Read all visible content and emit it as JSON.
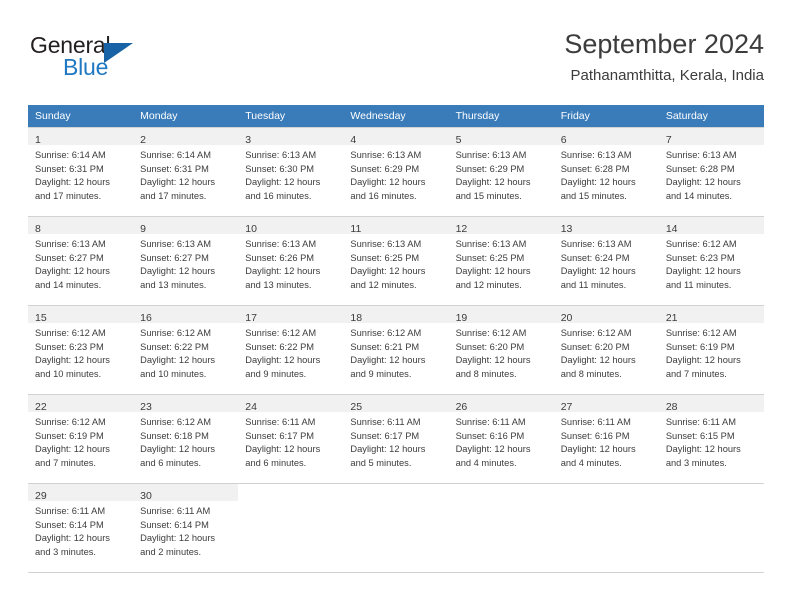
{
  "brand": {
    "name_top": "General",
    "name_bottom": "Blue",
    "triangle_color": "#1763a6",
    "blue_color": "#1f78c1"
  },
  "header": {
    "title": "September 2024",
    "subtitle": "Pathanamthitta, Kerala, India"
  },
  "theme": {
    "header_row_bg": "#3a7cba",
    "daynum_bg": "#f1f1f1",
    "text_color": "#3c3c3c",
    "grid_line": "#d2d2d2"
  },
  "weekdays": [
    "Sunday",
    "Monday",
    "Tuesday",
    "Wednesday",
    "Thursday",
    "Friday",
    "Saturday"
  ],
  "weeks": [
    [
      {
        "day": "1",
        "sunrise": "Sunrise: 6:14 AM",
        "sunset": "Sunset: 6:31 PM",
        "daylight1": "Daylight: 12 hours",
        "daylight2": "and 17 minutes."
      },
      {
        "day": "2",
        "sunrise": "Sunrise: 6:14 AM",
        "sunset": "Sunset: 6:31 PM",
        "daylight1": "Daylight: 12 hours",
        "daylight2": "and 17 minutes."
      },
      {
        "day": "3",
        "sunrise": "Sunrise: 6:13 AM",
        "sunset": "Sunset: 6:30 PM",
        "daylight1": "Daylight: 12 hours",
        "daylight2": "and 16 minutes."
      },
      {
        "day": "4",
        "sunrise": "Sunrise: 6:13 AM",
        "sunset": "Sunset: 6:29 PM",
        "daylight1": "Daylight: 12 hours",
        "daylight2": "and 16 minutes."
      },
      {
        "day": "5",
        "sunrise": "Sunrise: 6:13 AM",
        "sunset": "Sunset: 6:29 PM",
        "daylight1": "Daylight: 12 hours",
        "daylight2": "and 15 minutes."
      },
      {
        "day": "6",
        "sunrise": "Sunrise: 6:13 AM",
        "sunset": "Sunset: 6:28 PM",
        "daylight1": "Daylight: 12 hours",
        "daylight2": "and 15 minutes."
      },
      {
        "day": "7",
        "sunrise": "Sunrise: 6:13 AM",
        "sunset": "Sunset: 6:28 PM",
        "daylight1": "Daylight: 12 hours",
        "daylight2": "and 14 minutes."
      }
    ],
    [
      {
        "day": "8",
        "sunrise": "Sunrise: 6:13 AM",
        "sunset": "Sunset: 6:27 PM",
        "daylight1": "Daylight: 12 hours",
        "daylight2": "and 14 minutes."
      },
      {
        "day": "9",
        "sunrise": "Sunrise: 6:13 AM",
        "sunset": "Sunset: 6:27 PM",
        "daylight1": "Daylight: 12 hours",
        "daylight2": "and 13 minutes."
      },
      {
        "day": "10",
        "sunrise": "Sunrise: 6:13 AM",
        "sunset": "Sunset: 6:26 PM",
        "daylight1": "Daylight: 12 hours",
        "daylight2": "and 13 minutes."
      },
      {
        "day": "11",
        "sunrise": "Sunrise: 6:13 AM",
        "sunset": "Sunset: 6:25 PM",
        "daylight1": "Daylight: 12 hours",
        "daylight2": "and 12 minutes."
      },
      {
        "day": "12",
        "sunrise": "Sunrise: 6:13 AM",
        "sunset": "Sunset: 6:25 PM",
        "daylight1": "Daylight: 12 hours",
        "daylight2": "and 12 minutes."
      },
      {
        "day": "13",
        "sunrise": "Sunrise: 6:13 AM",
        "sunset": "Sunset: 6:24 PM",
        "daylight1": "Daylight: 12 hours",
        "daylight2": "and 11 minutes."
      },
      {
        "day": "14",
        "sunrise": "Sunrise: 6:12 AM",
        "sunset": "Sunset: 6:23 PM",
        "daylight1": "Daylight: 12 hours",
        "daylight2": "and 11 minutes."
      }
    ],
    [
      {
        "day": "15",
        "sunrise": "Sunrise: 6:12 AM",
        "sunset": "Sunset: 6:23 PM",
        "daylight1": "Daylight: 12 hours",
        "daylight2": "and 10 minutes."
      },
      {
        "day": "16",
        "sunrise": "Sunrise: 6:12 AM",
        "sunset": "Sunset: 6:22 PM",
        "daylight1": "Daylight: 12 hours",
        "daylight2": "and 10 minutes."
      },
      {
        "day": "17",
        "sunrise": "Sunrise: 6:12 AM",
        "sunset": "Sunset: 6:22 PM",
        "daylight1": "Daylight: 12 hours",
        "daylight2": "and 9 minutes."
      },
      {
        "day": "18",
        "sunrise": "Sunrise: 6:12 AM",
        "sunset": "Sunset: 6:21 PM",
        "daylight1": "Daylight: 12 hours",
        "daylight2": "and 9 minutes."
      },
      {
        "day": "19",
        "sunrise": "Sunrise: 6:12 AM",
        "sunset": "Sunset: 6:20 PM",
        "daylight1": "Daylight: 12 hours",
        "daylight2": "and 8 minutes."
      },
      {
        "day": "20",
        "sunrise": "Sunrise: 6:12 AM",
        "sunset": "Sunset: 6:20 PM",
        "daylight1": "Daylight: 12 hours",
        "daylight2": "and 8 minutes."
      },
      {
        "day": "21",
        "sunrise": "Sunrise: 6:12 AM",
        "sunset": "Sunset: 6:19 PM",
        "daylight1": "Daylight: 12 hours",
        "daylight2": "and 7 minutes."
      }
    ],
    [
      {
        "day": "22",
        "sunrise": "Sunrise: 6:12 AM",
        "sunset": "Sunset: 6:19 PM",
        "daylight1": "Daylight: 12 hours",
        "daylight2": "and 7 minutes."
      },
      {
        "day": "23",
        "sunrise": "Sunrise: 6:12 AM",
        "sunset": "Sunset: 6:18 PM",
        "daylight1": "Daylight: 12 hours",
        "daylight2": "and 6 minutes."
      },
      {
        "day": "24",
        "sunrise": "Sunrise: 6:11 AM",
        "sunset": "Sunset: 6:17 PM",
        "daylight1": "Daylight: 12 hours",
        "daylight2": "and 6 minutes."
      },
      {
        "day": "25",
        "sunrise": "Sunrise: 6:11 AM",
        "sunset": "Sunset: 6:17 PM",
        "daylight1": "Daylight: 12 hours",
        "daylight2": "and 5 minutes."
      },
      {
        "day": "26",
        "sunrise": "Sunrise: 6:11 AM",
        "sunset": "Sunset: 6:16 PM",
        "daylight1": "Daylight: 12 hours",
        "daylight2": "and 4 minutes."
      },
      {
        "day": "27",
        "sunrise": "Sunrise: 6:11 AM",
        "sunset": "Sunset: 6:16 PM",
        "daylight1": "Daylight: 12 hours",
        "daylight2": "and 4 minutes."
      },
      {
        "day": "28",
        "sunrise": "Sunrise: 6:11 AM",
        "sunset": "Sunset: 6:15 PM",
        "daylight1": "Daylight: 12 hours",
        "daylight2": "and 3 minutes."
      }
    ],
    [
      {
        "day": "29",
        "sunrise": "Sunrise: 6:11 AM",
        "sunset": "Sunset: 6:14 PM",
        "daylight1": "Daylight: 12 hours",
        "daylight2": "and 3 minutes."
      },
      {
        "day": "30",
        "sunrise": "Sunrise: 6:11 AM",
        "sunset": "Sunset: 6:14 PM",
        "daylight1": "Daylight: 12 hours",
        "daylight2": "and 2 minutes."
      },
      null,
      null,
      null,
      null,
      null
    ]
  ]
}
